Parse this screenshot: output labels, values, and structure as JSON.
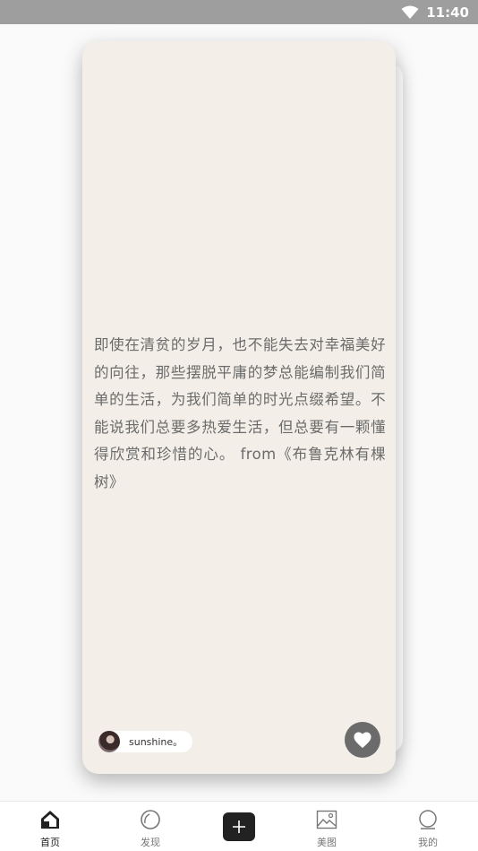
{
  "status_bar": {
    "time": "11:40",
    "icons": [
      "wifi-icon"
    ]
  },
  "card": {
    "quote": "即使在清贫的岁月，也不能失去对幸福美好的向往，那些摆脱平庸的梦总能编制我们简单的生活，为我们简单的时光点缀希望。不能说我们总要多热爱生活，但总要有一颗懂得欣赏和珍惜的心。 from《布鲁克林有棵树》",
    "author": "sunshine。",
    "like_icon": "heart-icon"
  },
  "tab_bar": {
    "tabs": [
      {
        "label": "首页",
        "icon": "home-icon",
        "active": true
      },
      {
        "label": "发现",
        "icon": "circle-icon",
        "active": false
      },
      {
        "label": "",
        "icon": "plus-icon",
        "active": false
      },
      {
        "label": "美图",
        "icon": "image-icon",
        "active": false
      },
      {
        "label": "我的",
        "icon": "user-icon",
        "active": false
      }
    ]
  },
  "colors": {
    "card_background": "#f3efe8",
    "status_bar": "#9e9e9e",
    "quote_text": "#6b6b6b",
    "like_button": "#6b6b6b"
  }
}
